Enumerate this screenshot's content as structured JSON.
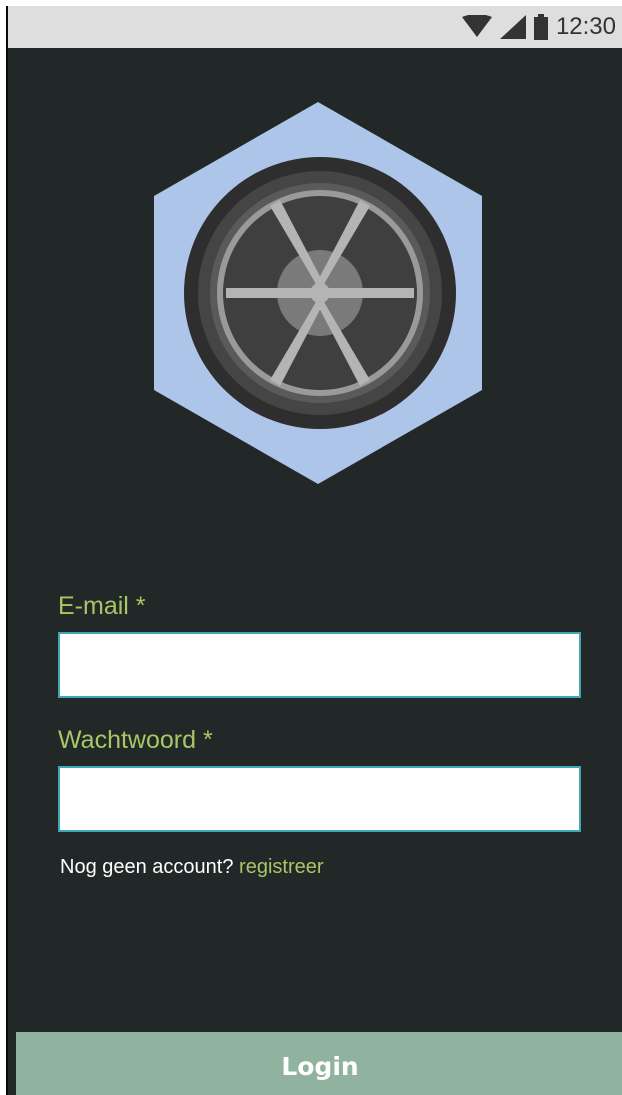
{
  "status_bar": {
    "time": "12:30",
    "icons": [
      "wifi-icon",
      "signal-icon",
      "battery-icon"
    ]
  },
  "logo": {
    "icon": "wheel-logo-icon",
    "colors": {
      "hexagon": "#aec5ea",
      "tire": "#3a3a3a",
      "rim": "#b0b0b0",
      "hub": "#7a7a7a"
    }
  },
  "form": {
    "email_label": "E-mail *",
    "email_value": "",
    "password_label": "Wachtwoord *",
    "password_value": "",
    "register_prompt": "Nog geen account?",
    "register_link": "registreer"
  },
  "login_button": {
    "label": "Login"
  },
  "colors": {
    "background": "#212827",
    "accent": "#a8c665",
    "input_border": "#3ea9b4",
    "button": "#8fb39e",
    "status_bar": "#dedede"
  }
}
